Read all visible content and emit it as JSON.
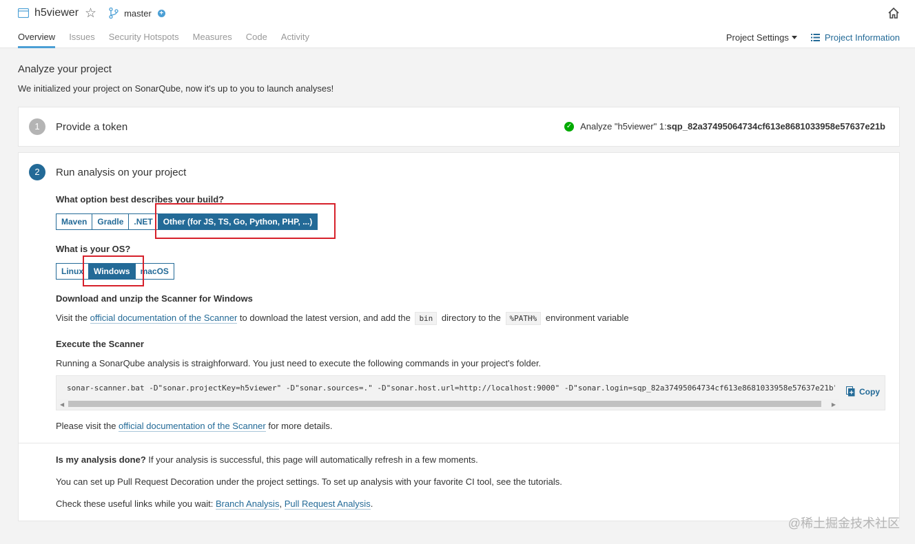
{
  "header": {
    "project_name": "h5viewer",
    "branch": "master",
    "plus_glyph": "+",
    "star_glyph": "☆",
    "tabs": [
      "Overview",
      "Issues",
      "Security Hotspots",
      "Measures",
      "Code",
      "Activity"
    ],
    "project_settings": "Project Settings",
    "project_information": "Project Information"
  },
  "page": {
    "title": "Analyze your project",
    "subtitle": "We initialized your project on SonarQube, now it's up to you to launch analyses!"
  },
  "step1": {
    "number": "1",
    "title": "Provide a token",
    "check_glyph": "✓",
    "result_prefix": "Analyze \"h5viewer\" 1: ",
    "token": "sqp_82a37495064734cf613e8681033958e57637e21b"
  },
  "step2": {
    "number": "2",
    "title": "Run analysis on your project",
    "build_question": "What option best describes your build?",
    "build_options": [
      "Maven",
      "Gradle",
      ".NET",
      "Other (for JS, TS, Go, Python, PHP, ...)"
    ],
    "os_question": "What is your OS?",
    "os_options": [
      "Linux",
      "Windows",
      "macOS"
    ],
    "download_heading": "Download and unzip the Scanner for Windows",
    "download_pre": "Visit the ",
    "download_link": "official documentation of the Scanner",
    "download_mid": " to download the latest version, and add the ",
    "download_code1": "bin",
    "download_mid2": " directory to the ",
    "download_code2": "%PATH%",
    "download_post": " environment variable",
    "execute_heading": "Execute the Scanner",
    "execute_text": "Running a SonarQube analysis is straighforward. You just need to execute the following commands in your project's folder.",
    "command": "sonar-scanner.bat -D\"sonar.projectKey=h5viewer\" -D\"sonar.sources=.\" -D\"sonar.host.url=http://localhost:9000\" -D\"sonar.login=sqp_82a37495064734cf613e8681033958e57637e21b\"",
    "copy_label": "Copy",
    "details_pre": "Please visit the ",
    "details_link": "official documentation of the Scanner",
    "details_post": " for more details.",
    "done_bold": "Is my analysis done?",
    "done_text": " If your analysis is successful, this page will automatically refresh in a few moments.",
    "pr_text": "You can set up Pull Request Decoration under the project settings. To set up analysis with your favorite CI tool, see the tutorials.",
    "links_pre": "Check these useful links while you wait: ",
    "link_branch": "Branch Analysis",
    "link_sep": ", ",
    "link_pr": "Pull Request Analysis",
    "links_post": "."
  },
  "watermark": "@稀土掘金技术社区",
  "colors": {
    "accent": "#236a97",
    "success": "#00aa00",
    "highlight_box": "#d6202a"
  }
}
